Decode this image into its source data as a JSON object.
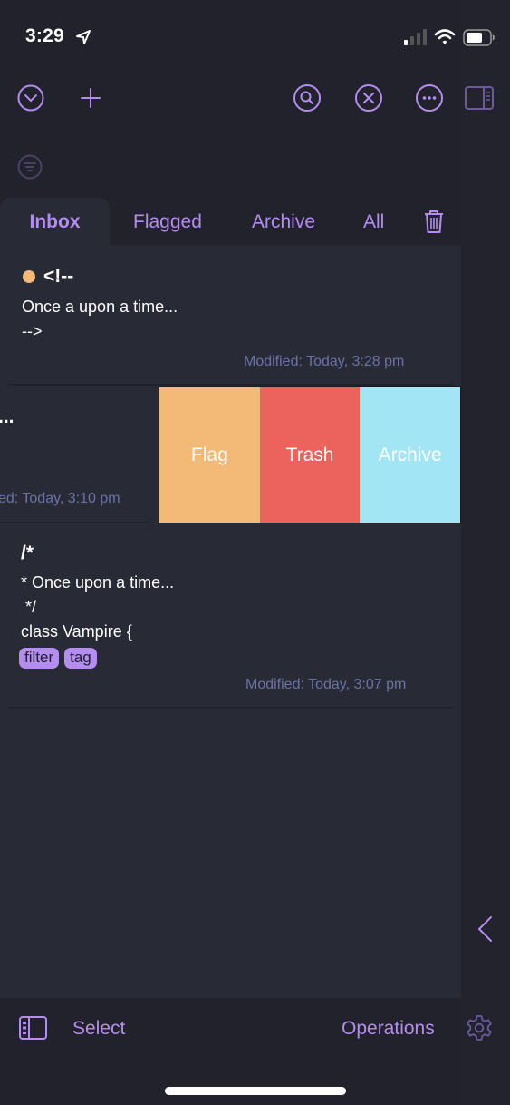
{
  "status_bar": {
    "time": "3:29",
    "location_icon": "location-arrow-icon",
    "signal_icon": "cellular-signal-icon",
    "wifi_icon": "wifi-icon",
    "battery_icon": "battery-icon"
  },
  "toolbar": {
    "left_icons": [
      "chevron-down-circle-icon",
      "plus-icon"
    ],
    "right_icons": [
      "search-circle-icon",
      "close-circle-icon",
      "more-circle-icon",
      "sidebar-right-icon"
    ],
    "filter_icon": "filter-circle-icon"
  },
  "tabs": [
    {
      "label": "Inbox",
      "active": true
    },
    {
      "label": "Flagged",
      "active": false
    },
    {
      "label": "Archive",
      "active": false
    },
    {
      "label": "All",
      "active": false
    }
  ],
  "tabs_trash_icon": "trash-icon",
  "notes": [
    {
      "flagged": true,
      "title": "<!--",
      "lines": [
        "Once a upon a time...",
        "-->"
      ],
      "modified": "Modified: Today, 3:28 pm"
    },
    {
      "title": "...",
      "lines": [],
      "modified": "ed: Today, 3:10 pm",
      "swipe_actions": [
        {
          "label": "Flag",
          "color": "#f3b976"
        },
        {
          "label": "Trash",
          "color": "#ec625d"
        },
        {
          "label": "Archive",
          "color": "#a2e6f6"
        }
      ]
    },
    {
      "title": "/*",
      "lines": [
        "* Once upon a time...",
        " */",
        "class Vampire {"
      ],
      "tags": [
        "filter",
        "tag"
      ],
      "modified": "Modified: Today, 3:07 pm"
    }
  ],
  "right_rail": {
    "collapse_icon": "chevron-left-icon",
    "settings_icon": "gear-icon"
  },
  "bottom_bar": {
    "sidebar_icon": "sidebar-left-icon",
    "select_label": "Select",
    "operations_label": "Operations"
  },
  "colors": {
    "accent": "#b58cf0",
    "background": "#21222c",
    "list_background": "#282a36",
    "date_text": "#6b73a6",
    "flag": "#f3b976",
    "trash": "#ec625d",
    "archive": "#a2e6f6"
  }
}
